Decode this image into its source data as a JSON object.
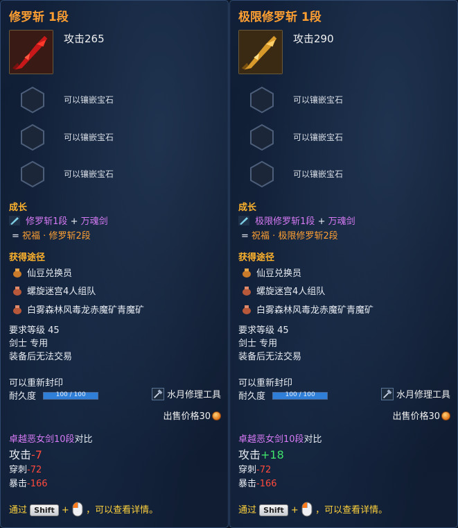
{
  "panels": [
    {
      "title": "修罗斩 1段",
      "attack": "攻击265",
      "weapon_color": "#c8181a",
      "gem_slots": [
        "可以镶嵌宝石",
        "可以镶嵌宝石",
        "可以镶嵌宝石"
      ],
      "growth": {
        "heading": "成长",
        "material1": "修罗斩1段",
        "plus": "+",
        "material2": "万魂剑",
        "result_prefix": "=",
        "result": "祝福 · 修罗斩2段"
      },
      "acquire": {
        "heading": "获得途径",
        "sources": [
          "仙豆兑换员",
          "螺旋迷宫4人组队",
          "白雾森林风毒龙赤魔矿青魔矿"
        ]
      },
      "requirements": [
        "要求等级 45",
        "剑士 专用",
        "装备后无法交易"
      ],
      "reseal": "可以重新封印",
      "durability_label": "耐久度",
      "durability_text": "100 / 100",
      "durability_ratio": 1.0,
      "repair_tool": "水月修理工具",
      "sell_label": "出售价格30",
      "compare": {
        "target": "卓越恶女剑10段",
        "suffix": "对比",
        "attack_label": "攻击",
        "attack_delta": "-7",
        "pierce_label": "穿刺",
        "pierce_delta": "-72",
        "crit_label": "暴击",
        "crit_delta": "-166"
      },
      "tip": {
        "prefix": "通过",
        "key": "Shift",
        "plus": "+",
        "suffix": "，可以查看详情。"
      }
    },
    {
      "title": "极限修罗斩 1段",
      "attack": "攻击290",
      "weapon_color": "#d89a2a",
      "gem_slots": [
        "可以镶嵌宝石",
        "可以镶嵌宝石",
        "可以镶嵌宝石"
      ],
      "growth": {
        "heading": "成长",
        "material1": "极限修罗斩1段",
        "plus": "+",
        "material2": "万魂剑",
        "result_prefix": "=",
        "result": "祝福 · 极限修罗斩2段"
      },
      "acquire": {
        "heading": "获得途径",
        "sources": [
          "仙豆兑换员",
          "螺旋迷宫4人组队",
          "白雾森林风毒龙赤魔矿青魔矿"
        ]
      },
      "requirements": [
        "要求等级 45",
        "剑士 专用",
        "装备后无法交易"
      ],
      "reseal": "可以重新封印",
      "durability_label": "耐久度",
      "durability_text": "100 / 100",
      "durability_ratio": 1.0,
      "repair_tool": "水月修理工具",
      "sell_label": "出售价格30",
      "compare": {
        "target": "卓越恶女剑10段",
        "suffix": "对比",
        "attack_label": "攻击",
        "attack_delta": "+18",
        "pierce_label": "穿刺",
        "pierce_delta": "-72",
        "crit_label": "暴击",
        "crit_delta": "-166"
      },
      "tip": {
        "prefix": "通过",
        "key": "Shift",
        "plus": "+",
        "suffix": "，可以查看详情。"
      }
    }
  ],
  "icons": {
    "gem_slot": "hexagon-socket-icon",
    "growth_material": "sword-material-icon",
    "source": "pouch-icon",
    "repair": "repair-hammer-icon",
    "currency": "coin-icon",
    "mouse": "mouse-icon"
  }
}
